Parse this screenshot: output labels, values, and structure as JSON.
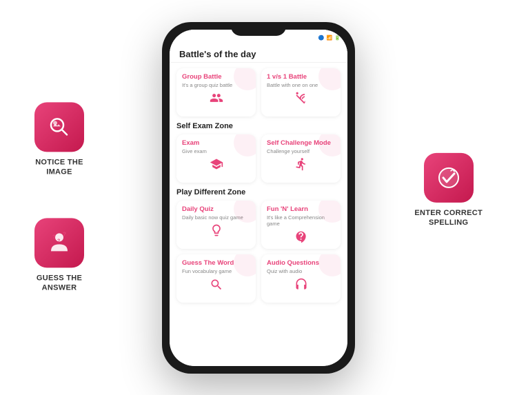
{
  "left_icons": [
    {
      "id": "notice-image",
      "label": "NOTICE THE\nIMAGE",
      "icon": "search"
    },
    {
      "id": "guess-answer",
      "label": "GUESS THE\nANSWER",
      "icon": "person-question"
    }
  ],
  "right_icons": [
    {
      "id": "enter-spelling",
      "label": "ENTER CORRECT\nSPELLING",
      "icon": "check-circle"
    }
  ],
  "phone": {
    "header": "Battle's of the day",
    "status": "🔋📶",
    "sections": [
      {
        "title": "",
        "cards": [
          {
            "title": "Group Battle",
            "desc": "It's a group quiz battle",
            "icon": "group"
          },
          {
            "title": "1 v/s 1 Battle",
            "desc": "Battle with one on one",
            "icon": "handshake"
          }
        ]
      },
      {
        "title": "Self Exam Zone",
        "cards": [
          {
            "title": "Exam",
            "desc": "Give exam",
            "icon": "graduation"
          },
          {
            "title": "Self Challenge Mode",
            "desc": "Challenge yourself",
            "icon": "challenge"
          }
        ]
      },
      {
        "title": "Play Different Zone",
        "cards": [
          {
            "title": "Daily Quiz",
            "desc": "Daily basic now quiz game",
            "icon": "bulb"
          },
          {
            "title": "Fun 'N' Learn",
            "desc": "It's like a Comprehension game",
            "icon": "planet"
          }
        ]
      },
      {
        "title": "",
        "cards": [
          {
            "title": "Guess The Word",
            "desc": "Fun vocabulary game",
            "icon": "search"
          },
          {
            "title": "Audio Questions",
            "desc": "Quiz with audio",
            "icon": "headphone"
          }
        ]
      }
    ]
  }
}
